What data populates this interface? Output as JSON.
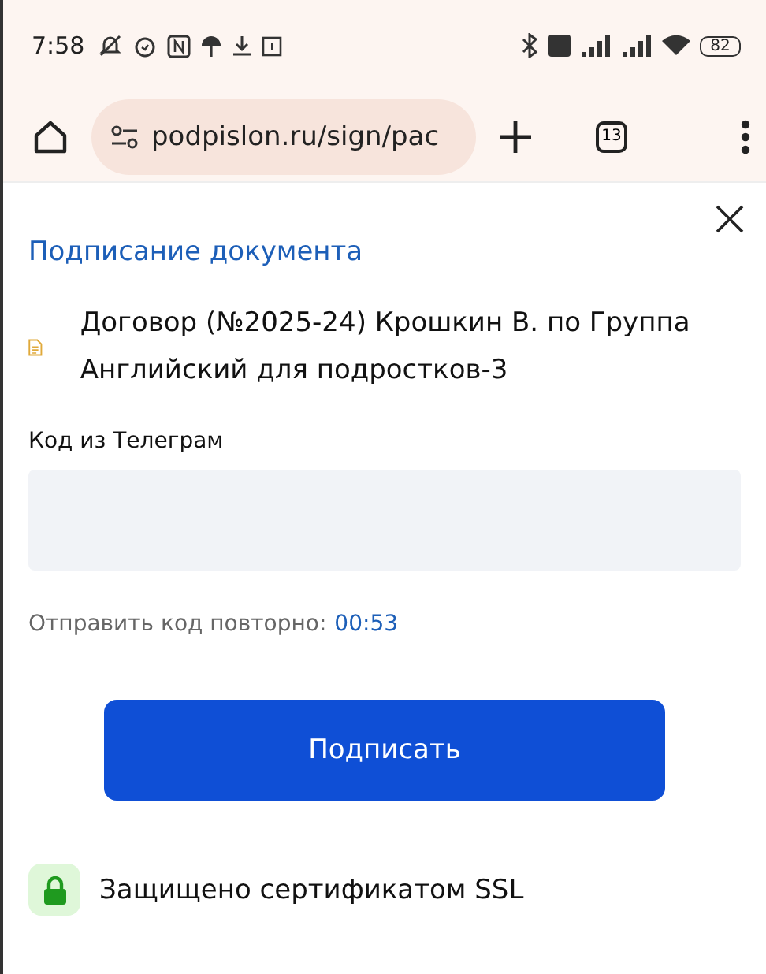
{
  "status_bar": {
    "time": "7:58",
    "battery": "82"
  },
  "browser": {
    "url": "podpislon.ru/sign/pac",
    "tab_count": "13"
  },
  "dialog": {
    "title": "Подписание документа",
    "document": "Договор (№2025-24) Крошкин В. по Группа Английский для подростков-3",
    "code_label": "Код из Телеграм",
    "resend_label": "Отправить код повторно:",
    "resend_timer": "00:53",
    "sign_button": "Подписать",
    "ssl_note": "Защищено сертификатом SSL"
  }
}
